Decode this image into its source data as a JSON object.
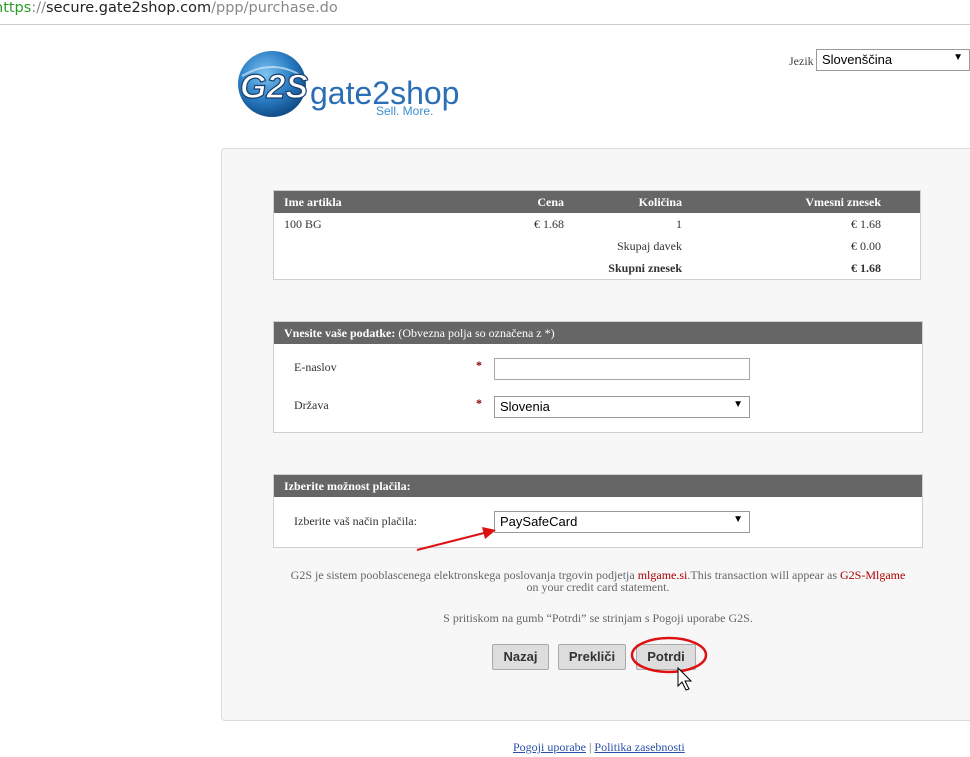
{
  "browser": {
    "url_scheme": "https",
    "url_sep": "://",
    "url_host": "secure.gate2shop.com",
    "url_path": "/ppp/purchase.do"
  },
  "logo": {
    "mark": "G2S",
    "name": "gate2shop",
    "tagline": "Sell. More."
  },
  "language": {
    "label": "Jezik",
    "selected": "Slovenščina"
  },
  "items_table": {
    "headers": [
      "Ime artikla",
      "Cena",
      "Količina",
      "Vmesni znesek"
    ],
    "rows": [
      {
        "name": "100 BG",
        "price": "€ 1.68",
        "qty": "1",
        "subtotal": "€ 1.68"
      }
    ],
    "tax_label": "Skupaj davek",
    "tax_value": "€ 0.00",
    "total_label": "Skupni znesek",
    "total_value": "€ 1.68"
  },
  "details_form": {
    "header_bold": "Vnesite vaše podatke:",
    "header_note": " (Obvezna polja so označena z *)",
    "email_label": "E-naslov",
    "email_value": "",
    "country_label": "Država",
    "country_selected": "Slovenia",
    "required_mark": "*"
  },
  "payment": {
    "header": "Izberite možnost plačila:",
    "method_label": "Izberite vaš način plačila:",
    "method_selected": "PaySafeCard"
  },
  "info": {
    "line1_a": "G2S je sistem pooblascenega elektronskega poslovanja trgovin podjetja ",
    "merchant": "mlgame.si",
    "line1_b": ".This transaction will appear as ",
    "descriptor": "G2S-Mlgame",
    "line2": "on your credit card statement.",
    "terms": "S pritiskom na gumb “Potrdi” se strinjam s Pogoji uporabe G2S."
  },
  "buttons": {
    "back": "Nazaj",
    "cancel": "Prekliči",
    "confirm": "Potrdi"
  },
  "footer": {
    "terms_link": "Pogoji uporabe",
    "separator": "|",
    "privacy_link": "Politika zasebnosti"
  },
  "colors": {
    "header_bg": "#666666",
    "annotation": "#dd1111",
    "link": "#2a4fa8"
  }
}
